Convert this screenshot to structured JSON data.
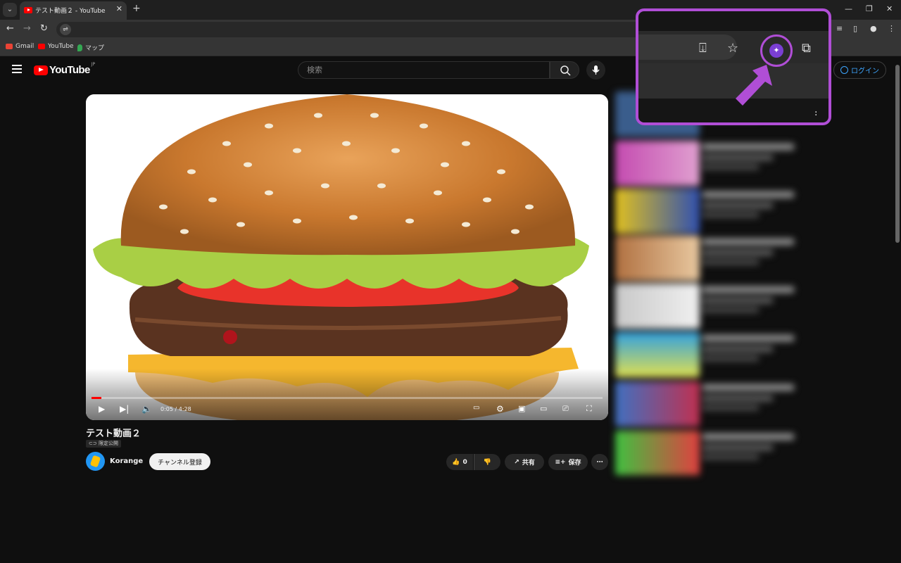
{
  "browser": {
    "tab_title": "テスト動画２ - YouTube",
    "tab_close": "✕",
    "new_tab": "+",
    "window_controls": [
      "—",
      "❐",
      "✕"
    ],
    "bookmarks": [
      {
        "label": "Gmail",
        "icon": "gmail-icon",
        "color": "#ea4335"
      },
      {
        "label": "YouTube",
        "icon": "youtube-icon",
        "color": "#ff0000"
      },
      {
        "label": "マップ",
        "icon": "maps-icon",
        "color": "#34a853"
      }
    ]
  },
  "youtube": {
    "region": "JP",
    "logo_text": "YouTube",
    "search_placeholder": "検索",
    "login_label": "ログイン"
  },
  "video": {
    "title": "テスト動画２",
    "visibility": "限定公開",
    "time": "0:05 / 4:28",
    "progress": 0.019,
    "channel_name": "Korange",
    "subscribe_label": "チャンネル登録",
    "like_count": "0",
    "share_label": "共有",
    "save_label": "保存"
  },
  "colors": {
    "accent_callout": "#b04ed6",
    "youtube_red": "#ff0000",
    "link_blue": "#3ea6ff"
  }
}
